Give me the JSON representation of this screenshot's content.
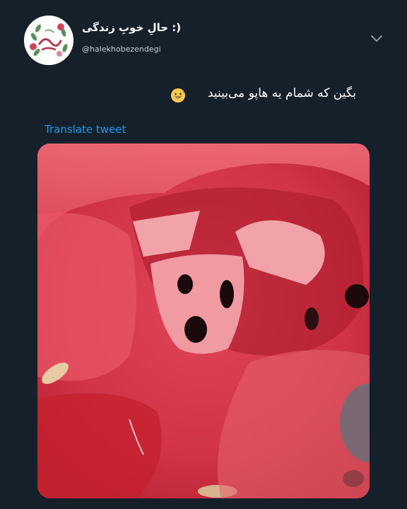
{
  "author": {
    "display_name": "حالِ خوبِ زندگی :)",
    "handle": "@halekhobezendegi",
    "avatar_icon": "floral-logo-icon"
  },
  "tweet": {
    "text": "بگین که شمام یه هاپو می‌بینید",
    "emoji": "grinning-sweat-emoji-icon",
    "translate_label": "Translate tweet"
  },
  "media": {
    "description_icon": "watermelon-puppy-photo"
  },
  "colors": {
    "background": "#15202b",
    "link": "#1d9bf0",
    "text": "#ffffff"
  }
}
